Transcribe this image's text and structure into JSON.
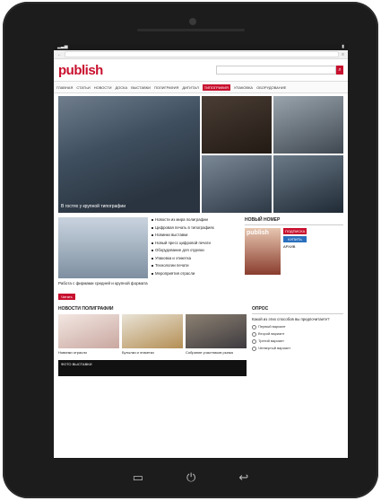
{
  "header": {
    "logo": "publish"
  },
  "nav": {
    "items": [
      "ГЛАВНАЯ",
      "СТАТЬИ",
      "НОВОСТИ",
      "ДОСКА",
      "ВЫСТАВКИ",
      "ПОЛИГРАФИЯ",
      "ДИГИТАЛ",
      "ТИПОГРАФИЯ",
      "УПАКОВКА",
      "ОБОРУДОВАНИЕ"
    ],
    "highlight": "ТИПОГРАФИЯ"
  },
  "hero": {
    "caption": "В гостях у крупной типографии"
  },
  "mid": {
    "article_title": "Работа с фирмами средней и крупной формата",
    "list": [
      "Новости из мира полиграфии",
      "Цифровая печать в типографиях",
      "Новинки выставки",
      "Новый пресс цифровой печати",
      "Оборудование для отделки",
      "Упаковка и этикетка",
      "Технологии печати",
      "Мероприятия отрасли"
    ],
    "read_more": "Читать"
  },
  "side": {
    "title": "НОВЫЙ НОМЕР",
    "cover": "publish",
    "subscribe": "ПОДПИСКА",
    "buy": "КУПИТЬ",
    "archive": "АРХИВ",
    "poll_title": "ОПРОС",
    "poll_question": "Какой из этих способов вы предпочитаете?",
    "poll_options": [
      "Первый вариант",
      "Второй вариант",
      "Третий вариант",
      "Четвертый вариант"
    ]
  },
  "section": {
    "title": "НОВОСТИ ПОЛИГРАФИИ",
    "promo": "ФОТО ВЫСТАВКИ",
    "cards": [
      "Новинки отрасли",
      "Бутылки и этикетки",
      "Собрание участников рынка"
    ]
  },
  "colors": {
    "brand": "#c8102e",
    "device": "#1c1c1c"
  }
}
